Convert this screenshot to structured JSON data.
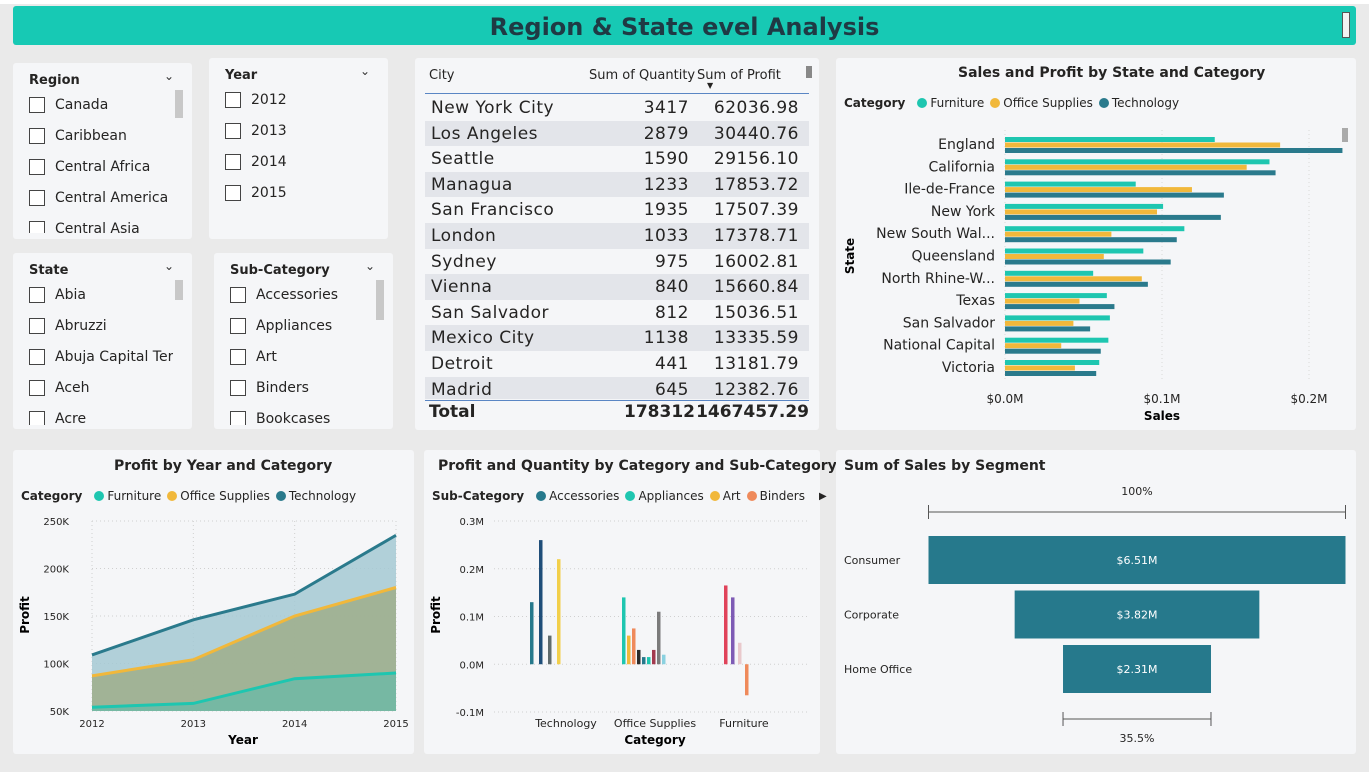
{
  "header": {
    "title": "Region & State evel Analysis"
  },
  "colors": {
    "furniture": "#1ec6b0",
    "office": "#f1b83b",
    "technology": "#2a7a8c",
    "accessories": "#26798c",
    "appliances": "#1ec6b0",
    "art": "#f1b83b",
    "binders": "#ef8a5b",
    "header_bg": "#17c9b4"
  },
  "slicers": {
    "region": {
      "label": "Region",
      "items": [
        "Canada",
        "Caribbean",
        "Central Africa",
        "Central America",
        "Central Asia"
      ]
    },
    "year": {
      "label": "Year",
      "items": [
        "2012",
        "2013",
        "2014",
        "2015"
      ]
    },
    "state": {
      "label": "State",
      "items": [
        "Abia",
        "Abruzzi",
        "Abuja Capital Ter...",
        "Aceh",
        "Acre"
      ]
    },
    "subcategory": {
      "label": "Sub-Category",
      "items": [
        "Accessories",
        "Appliances",
        "Art",
        "Binders",
        "Bookcases"
      ]
    }
  },
  "city_table": {
    "columns": [
      "City",
      "Sum of Quantity",
      "Sum of Profit"
    ],
    "rows": [
      {
        "city": "New York City",
        "qty": "3417",
        "profit": "62036.98"
      },
      {
        "city": "Los Angeles",
        "qty": "2879",
        "profit": "30440.76"
      },
      {
        "city": "Seattle",
        "qty": "1590",
        "profit": "29156.10"
      },
      {
        "city": "Managua",
        "qty": "1233",
        "profit": "17853.72"
      },
      {
        "city": "San Francisco",
        "qty": "1935",
        "profit": "17507.39"
      },
      {
        "city": "London",
        "qty": "1033",
        "profit": "17378.71"
      },
      {
        "city": "Sydney",
        "qty": "975",
        "profit": "16002.81"
      },
      {
        "city": "Vienna",
        "qty": "840",
        "profit": "15660.84"
      },
      {
        "city": "San Salvador",
        "qty": "812",
        "profit": "15036.51"
      },
      {
        "city": "Mexico City",
        "qty": "1138",
        "profit": "13335.59"
      },
      {
        "city": "Detroit",
        "qty": "441",
        "profit": "13181.79"
      },
      {
        "city": "Madrid",
        "qty": "645",
        "profit": "12382.76"
      }
    ],
    "total": {
      "label": "Total",
      "qty": "178312",
      "profit": "1467457.29"
    }
  },
  "chart_data": [
    {
      "id": "state_sales",
      "type": "bar",
      "orientation": "horizontal",
      "title": "Sales and Profit by State and Category",
      "legend_title": "Category",
      "xlabel": "Sales",
      "ylabel": "State",
      "xlim": [
        0,
        0.22
      ],
      "x_ticks": [
        "$0.0M",
        "$0.1M",
        "$0.2M"
      ],
      "categories": [
        "England",
        "California",
        "Ile-de-France",
        "New York",
        "New South Wal...",
        "Queensland",
        "North Rhine-W...",
        "Texas",
        "San Salvador",
        "National Capital",
        "Victoria"
      ],
      "series": [
        {
          "name": "Furniture",
          "values": [
            0.138,
            0.174,
            0.086,
            0.104,
            0.118,
            0.091,
            0.058,
            0.067,
            0.069,
            0.068,
            0.062
          ]
        },
        {
          "name": "Office Supplies",
          "values": [
            0.181,
            0.159,
            0.123,
            0.1,
            0.07,
            0.065,
            0.09,
            0.049,
            0.045,
            0.037,
            0.046
          ]
        },
        {
          "name": "Technology",
          "values": [
            0.222,
            0.178,
            0.144,
            0.142,
            0.113,
            0.109,
            0.094,
            0.072,
            0.056,
            0.063,
            0.06
          ]
        }
      ]
    },
    {
      "id": "profit_year",
      "type": "area",
      "title": "Profit by Year and Category",
      "legend_title": "Category",
      "xlabel": "Year",
      "ylabel": "Profit",
      "ylim": [
        50000,
        250000
      ],
      "y_ticks": [
        "250K",
        "200K",
        "150K",
        "100K",
        "50K"
      ],
      "x": [
        "2012",
        "2013",
        "2014",
        "2015"
      ],
      "series": [
        {
          "name": "Furniture",
          "values": [
            54000,
            58000,
            84000,
            90000
          ]
        },
        {
          "name": "Office Supplies",
          "values": [
            87000,
            104000,
            150000,
            180000
          ]
        },
        {
          "name": "Technology",
          "values": [
            109000,
            146000,
            173000,
            235000
          ]
        }
      ]
    },
    {
      "id": "profit_qty",
      "type": "bar",
      "title": "Profit and Quantity by Category and Sub-Category",
      "legend_title": "Sub-Category",
      "legend": [
        "Accessories",
        "Appliances",
        "Art",
        "Binders"
      ],
      "xlabel": "Category",
      "ylabel": "Profit",
      "ylim": [
        -0.1,
        0.3
      ],
      "y_ticks": [
        "0.3M",
        "0.2M",
        "0.1M",
        "0.0M",
        "-0.1M"
      ],
      "categories": [
        "Technology",
        "Office Supplies",
        "Furniture"
      ],
      "bars": [
        {
          "cat": 0,
          "values": [
            0.13,
            0.26,
            0.06,
            0.22
          ],
          "colors": [
            "#26798c",
            "#1f4e79",
            "#5f6b6d",
            "#f2cf4a"
          ]
        },
        {
          "cat": 1,
          "values": [
            0.14,
            0.06,
            0.075,
            0.03,
            0.015,
            0.015,
            0.03,
            0.11,
            0.02
          ],
          "colors": [
            "#1ec6b0",
            "#f1b83b",
            "#ef8a5b",
            "#2b2b2b",
            "#26798c",
            "#1ec6b0",
            "#a23a4e",
            "#7b7b7b",
            "#8ad1e0"
          ]
        },
        {
          "cat": 2,
          "values": [
            0.165,
            0.14,
            0.045,
            -0.065
          ],
          "colors": [
            "#e0435a",
            "#7e5bb5",
            "#e9c9cc",
            "#ef8a5b"
          ]
        }
      ]
    },
    {
      "id": "segment_sales",
      "type": "bar",
      "orientation": "funnel",
      "title": "Sum of Sales by Segment",
      "top_pct": "100%",
      "bottom_pct": "35.5%",
      "categories": [
        "Consumer",
        "Corporate",
        "Home Office"
      ],
      "values": [
        6.51,
        3.82,
        2.31
      ],
      "labels": [
        "$6.51M",
        "$3.82M",
        "$2.31M"
      ]
    }
  ]
}
